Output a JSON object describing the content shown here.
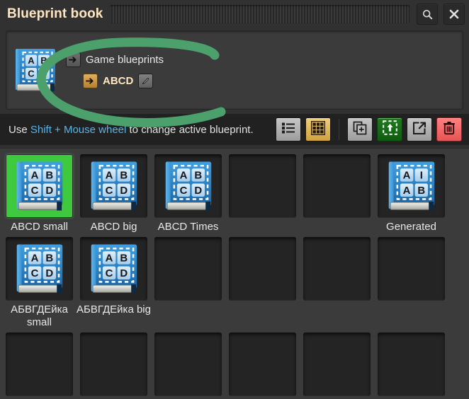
{
  "window": {
    "title": "Blueprint book",
    "search_icon": "search-icon",
    "close_icon": "close-icon"
  },
  "breadcrumb": {
    "book_icon": "blueprint-book-icon",
    "items": [
      {
        "label": "Game blueprints",
        "icon": "arrow-right-icon",
        "active": false
      },
      {
        "label": "ABCD",
        "icon": "arrow-right-icon",
        "active": true,
        "edit_icon": "pencil-icon"
      }
    ]
  },
  "toolbar": {
    "hint_prefix": "Use ",
    "hint_highlight": "Shift + Mouse wheel",
    "hint_suffix": " to change active blueprint.",
    "highlight_color": "#5bb4e8",
    "buttons": [
      {
        "name": "list-view-button",
        "icon": "list-icon",
        "state": "inactive"
      },
      {
        "name": "grid-view-button",
        "icon": "grid-icon",
        "state": "active"
      },
      {
        "name": "duplicate-button",
        "icon": "copy-plus-icon",
        "state": "inactive"
      },
      {
        "name": "import-string-button",
        "icon": "import-arrow-icon",
        "state": "green"
      },
      {
        "name": "export-button",
        "icon": "export-arrow-icon",
        "state": "inactive"
      },
      {
        "name": "delete-button",
        "icon": "trash-icon",
        "state": "red"
      }
    ]
  },
  "grid": {
    "columns": 6,
    "rows": [
      {
        "cells": [
          {
            "label": "ABCD small",
            "letters": [
              "A",
              "B",
              "C",
              "D"
            ],
            "selected": true,
            "empty": false
          },
          {
            "label": "ABCD big",
            "letters": [
              "A",
              "B",
              "C",
              "D"
            ],
            "selected": false,
            "empty": false
          },
          {
            "label": "ABCD Times",
            "letters": [
              "A",
              "B",
              "C",
              "D"
            ],
            "selected": false,
            "empty": false
          },
          {
            "label": "",
            "letters": [],
            "selected": false,
            "empty": true
          },
          {
            "label": "",
            "letters": [],
            "selected": false,
            "empty": true
          },
          {
            "label": "Generated",
            "letters": [
              "A",
              "I",
              "A",
              "B"
            ],
            "selected": false,
            "empty": false
          }
        ]
      },
      {
        "cells": [
          {
            "label": "АБВГДЕйка small",
            "letters": [
              "A",
              "B",
              "C",
              "D"
            ],
            "selected": false,
            "empty": false
          },
          {
            "label": "АБВГДЕйка big",
            "letters": [
              "A",
              "B",
              "C",
              "D"
            ],
            "selected": false,
            "empty": false
          },
          {
            "label": "",
            "letters": [],
            "selected": false,
            "empty": true
          },
          {
            "label": "",
            "letters": [],
            "selected": false,
            "empty": true
          },
          {
            "label": "",
            "letters": [],
            "selected": false,
            "empty": true
          },
          {
            "label": "",
            "letters": [],
            "selected": false,
            "empty": true
          }
        ]
      },
      {
        "cells": [
          {
            "label": "",
            "letters": [],
            "selected": false,
            "empty": true
          },
          {
            "label": "",
            "letters": [],
            "selected": false,
            "empty": true
          },
          {
            "label": "",
            "letters": [],
            "selected": false,
            "empty": true
          },
          {
            "label": "",
            "letters": [],
            "selected": false,
            "empty": true
          },
          {
            "label": "",
            "letters": [],
            "selected": false,
            "empty": true
          },
          {
            "label": "",
            "letters": [],
            "selected": false,
            "empty": true
          }
        ]
      }
    ]
  },
  "annotation": {
    "shape": "ellipse-highlight",
    "color": "#4ca06c",
    "stroke_width": 13
  }
}
